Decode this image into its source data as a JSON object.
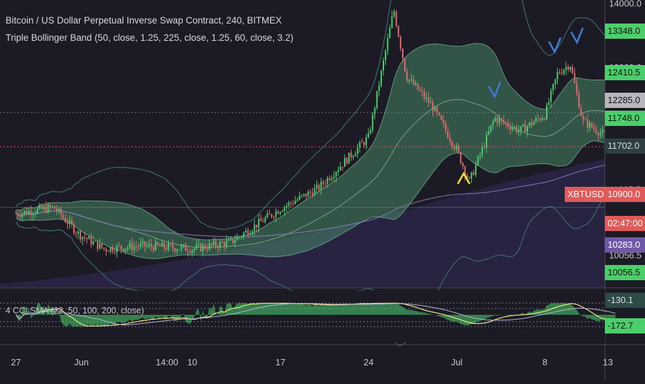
{
  "header": {
    "title": "Bitcoin / US Dollar Perpetual Inverse Swap Contract, 240, BITMEX",
    "indicator": "Triple Bollinger Band (50, close, 1.25, 225, close, 1.25, 60, close, 3.2)"
  },
  "subpane": {
    "label": "4 CCI SMA (22, 50, 100, 200, close)"
  },
  "badges": {
    "symbol": "XBTUSD",
    "countdown": "02:47:00",
    "p13348": "13348.0",
    "p12410": "12410.5",
    "p12285": "12285.0",
    "p11748": "11748.0",
    "p11702": "11702.0",
    "p10900": "10900.0",
    "p10283": "10283.0",
    "p10056": "10056.5",
    "cci1": "-130.1",
    "cci2": "-172.7"
  },
  "colors": {
    "background": "#1c1b25",
    "up": "#4ccf6b",
    "down": "#e06a6e",
    "band": "#4f9e72",
    "outer_band": "#3c6c66",
    "marker_blue": "#3d7bd6",
    "marker_yellow": "#f2e33a",
    "current_price": "#e05a5a"
  },
  "chart_data": {
    "type": "candlestick",
    "symbol": "XBTUSD",
    "interval": "240",
    "y_tick_labels": [
      "14000.0",
      "13000.0",
      "11085.5",
      "10056.5"
    ],
    "ylim": [
      9550,
      14050
    ],
    "x_tick_labels": [
      "27",
      "Jun",
      "14:00",
      "10",
      "17",
      "24",
      "Jul",
      "8",
      "13"
    ],
    "close_points": [
      {
        "x": "May 27",
        "y": 10700
      },
      {
        "x": "May 30",
        "y": 10800
      },
      {
        "x": "Jun 1",
        "y": 10380
      },
      {
        "x": "Jun 3",
        "y": 10150
      },
      {
        "x": "Jun 6",
        "y": 10200
      },
      {
        "x": "Jun 10",
        "y": 10150
      },
      {
        "x": "Jun 13",
        "y": 10250
      },
      {
        "x": "Jun 17",
        "y": 10780
      },
      {
        "x": "Jun 20",
        "y": 11100
      },
      {
        "x": "Jun 24",
        "y": 11900
      },
      {
        "x": "Jun 26",
        "y": 13900
      },
      {
        "x": "Jun 27",
        "y": 12850
      },
      {
        "x": "Jun 29",
        "y": 12400
      },
      {
        "x": "Jul 1",
        "y": 11700
      },
      {
        "x": "Jul 2",
        "y": 11200
      },
      {
        "x": "Jul 4",
        "y": 12200
      },
      {
        "x": "Jul 6",
        "y": 12000
      },
      {
        "x": "Jul 8",
        "y": 12250
      },
      {
        "x": "Jul 9",
        "y": 12900
      },
      {
        "x": "Jul 10",
        "y": 13050
      },
      {
        "x": "Jul 11",
        "y": 12150
      },
      {
        "x": "Jul 13",
        "y": 11900
      }
    ],
    "current_price": 11750,
    "markers": [
      {
        "shape": "v",
        "color": "#3d7bd6",
        "near": "Jul 4"
      },
      {
        "shape": "v",
        "color": "#3d7bd6",
        "near": "Jul 9"
      },
      {
        "shape": "v",
        "color": "#3d7bd6",
        "near": "Jul 10"
      },
      {
        "shape": "^",
        "color": "#f2e33a",
        "near": "Jul 1"
      }
    ],
    "grid": false
  }
}
